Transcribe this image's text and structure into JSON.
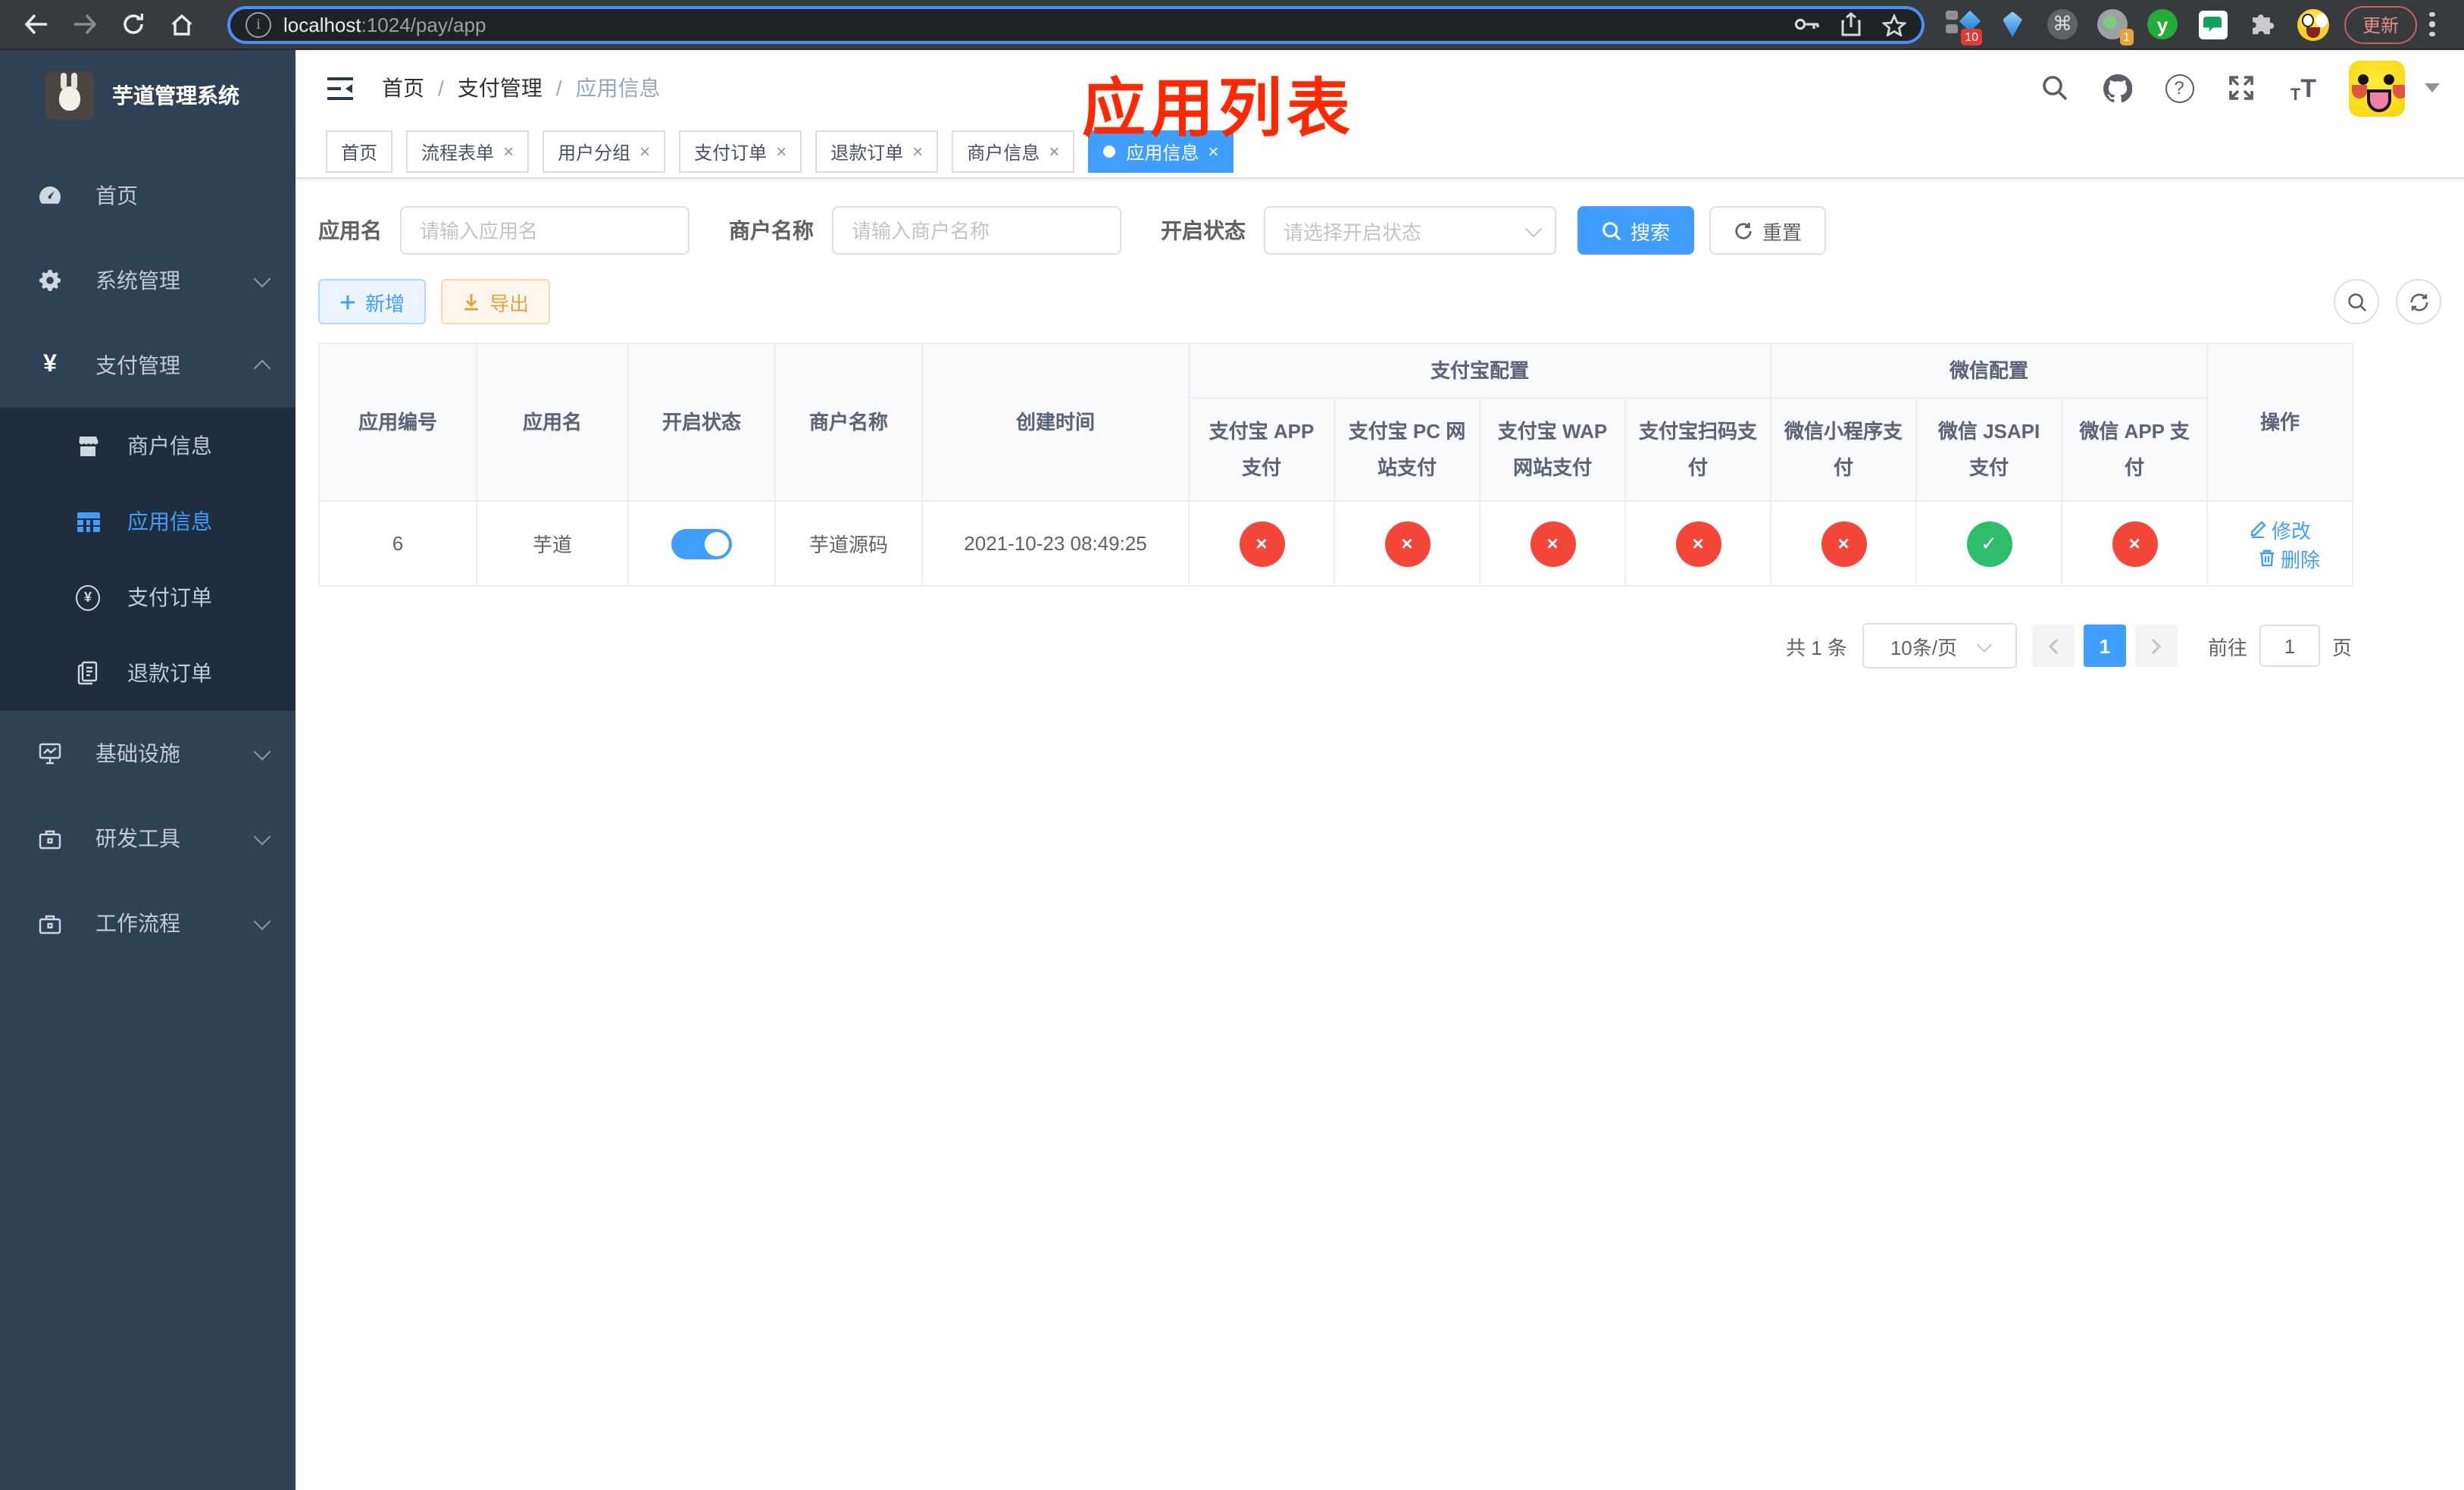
{
  "ui": {
    "x_glyph": "×",
    "check_glyph": "✓",
    "close_glyph": "×",
    "breadcrumb_separator": "/"
  },
  "browser": {
    "url_host": "localhost",
    "url_rest": ":1024/pay/app",
    "ext_badge_10": "10",
    "ext_badge_1": "1",
    "ext_y_label": "y",
    "update_button": "更新"
  },
  "sidebar": {
    "logo_title": "芋道管理系统",
    "menu_home": "首页",
    "menu_system": "系统管理",
    "menu_payment": "支付管理",
    "submenu_merchant": "商户信息",
    "submenu_app": "应用信息",
    "submenu_pay_order": "支付订单",
    "submenu_refund_order": "退款订单",
    "menu_infra": "基础设施",
    "menu_devtools": "研发工具",
    "menu_workflow": "工作流程"
  },
  "navbar": {
    "breadcrumb_home": "首页",
    "breadcrumb_level1": "支付管理",
    "breadcrumb_current": "应用信息"
  },
  "annotation": {
    "title": "应用列表",
    "color": "#ff2800"
  },
  "tabs": {
    "items": [
      {
        "label": "首页",
        "closable": false,
        "active": false
      },
      {
        "label": "流程表单",
        "closable": true,
        "active": false
      },
      {
        "label": "用户分组",
        "closable": true,
        "active": false
      },
      {
        "label": "支付订单",
        "closable": true,
        "active": false
      },
      {
        "label": "退款订单",
        "closable": true,
        "active": false
      },
      {
        "label": "商户信息",
        "closable": true,
        "active": false
      },
      {
        "label": "应用信息",
        "closable": true,
        "active": true
      }
    ]
  },
  "search_form": {
    "app_name_label": "应用名",
    "app_name_placeholder": "请输入应用名",
    "merchant_label": "商户名称",
    "merchant_placeholder": "请输入商户名称",
    "status_label": "开启状态",
    "status_placeholder": "请选择开启状态",
    "search_button": "搜索",
    "reset_button": "重置"
  },
  "toolbar": {
    "add_button": "新增",
    "export_button": "导出"
  },
  "table": {
    "headers": {
      "app_id": "应用编号",
      "app_name": "应用名",
      "status": "开启状态",
      "merchant": "商户名称",
      "create_time": "创建时间",
      "alipay_group": "支付宝配置",
      "wechat_group": "微信配置",
      "channel_cols": [
        "支付宝 APP 支付",
        "支付宝 PC 网站支付",
        "支付宝 WAP 网站支付",
        "支付宝扫码支付",
        "微信小程序支付",
        "微信 JSAPI 支付",
        "微信 APP 支付"
      ],
      "actions": "操作"
    },
    "row": {
      "app_id": "6",
      "app_name": "芋道",
      "status_on": true,
      "merchant": "芋道源码",
      "create_time": "2021-10-23 08:49:25",
      "channels": [
        "x",
        "x",
        "x",
        "x",
        "x",
        "check",
        "x"
      ],
      "edit_label": "修改",
      "delete_label": "删除"
    }
  },
  "pagination": {
    "total": "共 1 条",
    "page_size": "10条/页",
    "page": "1",
    "goto_label": "前往",
    "goto_value": "1",
    "page_unit": "页"
  },
  "colors": {
    "accent": "#409eff",
    "success": "#2ebd6b",
    "danger": "#f5463a",
    "warning": "#e6a23c",
    "sidebar_bg": "#304156",
    "submenu_bg": "#1f2d3d",
    "annotation_red": "#ff2800"
  }
}
